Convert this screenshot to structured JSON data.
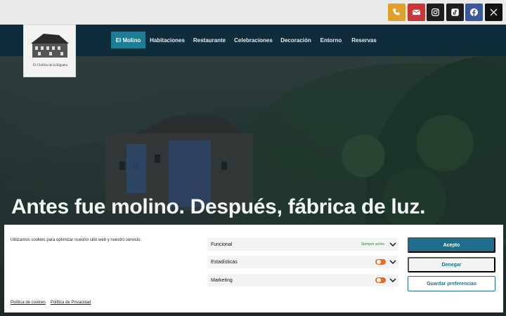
{
  "social": {
    "icons": [
      "phone-icon",
      "mail-icon",
      "instagram-icon",
      "tiktok-icon",
      "facebook-icon",
      "x-icon"
    ],
    "colors": {
      "phone": "#e0a12a",
      "mail": "#c8373a",
      "facebook": "#3b5998",
      "dark": "#1e1e1e"
    }
  },
  "logo": {
    "text": "El Chiflón de la Ríguera"
  },
  "nav": {
    "items": [
      "El Molino",
      "Habitaciones",
      "Restaurante",
      "Celebraciones",
      "Decoración",
      "Entorno",
      "Reservas"
    ],
    "active": "El Molino",
    "colors": {
      "bar": "#0e2c3a",
      "active": "#1d7d92"
    }
  },
  "hero": {
    "headline": "Antes fue molino. Después, fábrica de luz."
  },
  "cookie": {
    "message": "Utilizamos cookies para optimizar nuestro sitio web y nuestro servicio.",
    "categories": [
      {
        "label": "Funcional",
        "status": "Siempre activo"
      },
      {
        "label": "Estadísticas"
      },
      {
        "label": "Marketing"
      }
    ],
    "buttons": {
      "accept": "Acepto",
      "deny": "Denegar",
      "preferences": "Guardar preferencias"
    },
    "links": {
      "cookies": "Política de cookies",
      "privacy": "Política de Privacidad"
    },
    "colors": {
      "primary": "#1f6e8c",
      "toggle": "#e46a2b",
      "active_status": "#2a8a1f"
    }
  }
}
